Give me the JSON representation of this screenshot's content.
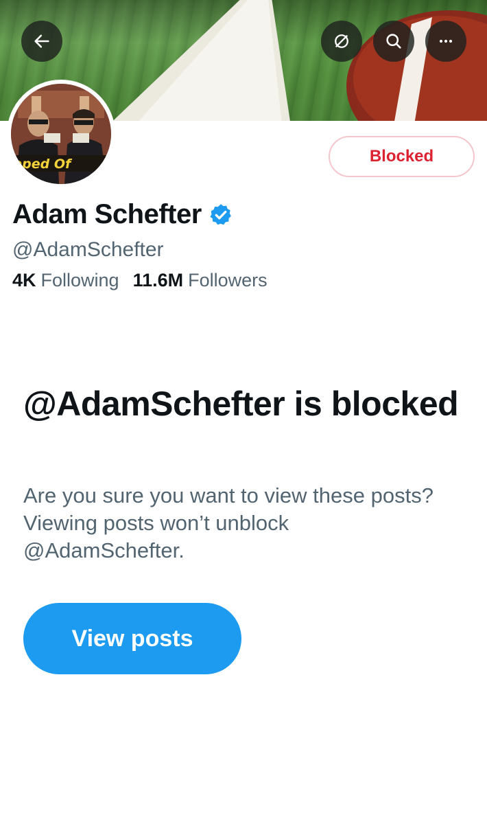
{
  "header": {
    "icons": {
      "back": "back-arrow-icon",
      "unfollow": "unfollow-icon",
      "search": "search-icon",
      "more": "more-icon"
    }
  },
  "profile": {
    "display_name": "Adam Schefter",
    "verified": true,
    "handle": "@AdamSchefter",
    "following_count": "4K",
    "following_label": "Following",
    "followers_count": "11.6M",
    "followers_label": "Followers",
    "relationship_button": "Blocked"
  },
  "blocked_notice": {
    "title": "@AdamSchefter is blocked",
    "description": "Are you sure you want to view these posts? Viewing posts won’t unblock @AdamSchefter.",
    "action_label": "View posts"
  },
  "colors": {
    "accent": "#1d9bf0",
    "blocked_red": "#dc2230",
    "text_primary": "#0f1419",
    "text_secondary": "#536471"
  }
}
